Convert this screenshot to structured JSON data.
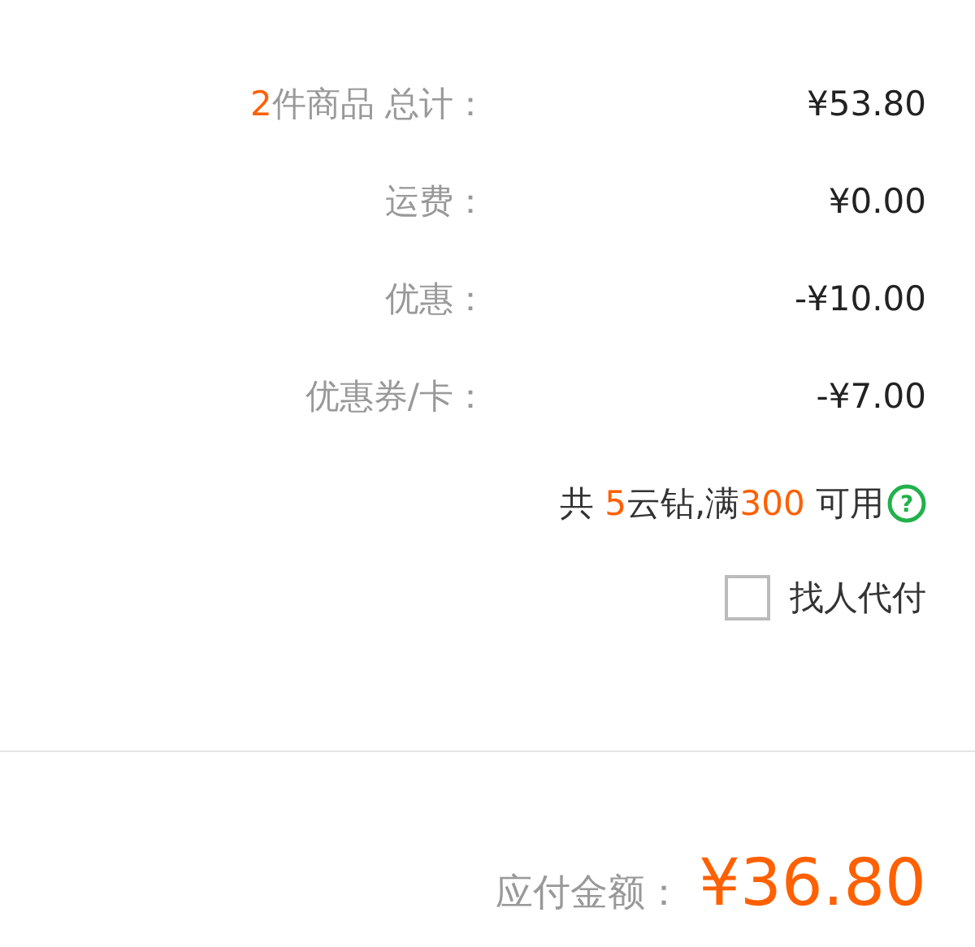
{
  "summary_rows": [
    {
      "label": [
        {
          "text": "2",
          "accent": true
        },
        {
          "text": "件商品 总计：",
          "accent": false
        }
      ],
      "value": "¥53.80"
    },
    {
      "label": [
        {
          "text": "运费：",
          "accent": false
        }
      ],
      "value": "¥0.00"
    },
    {
      "label": [
        {
          "text": "优惠：",
          "accent": false
        }
      ],
      "value": "-¥10.00"
    },
    {
      "label": [
        {
          "text": "优惠券/卡：",
          "accent": false
        }
      ],
      "value": "-¥7.00"
    }
  ],
  "cloud_diamonds": {
    "text": [
      {
        "text": "共 ",
        "accent": false
      },
      {
        "text": "5",
        "accent": true
      },
      {
        "text": "云钻,满",
        "accent": false
      },
      {
        "text": "300",
        "accent": true
      },
      {
        "text": " 可用",
        "accent": false
      }
    ],
    "help_icon": "?"
  },
  "pay_by_other": {
    "label": "找人代付",
    "checked": false
  },
  "total": {
    "label": "应付金额：",
    "value": "¥36.80"
  }
}
